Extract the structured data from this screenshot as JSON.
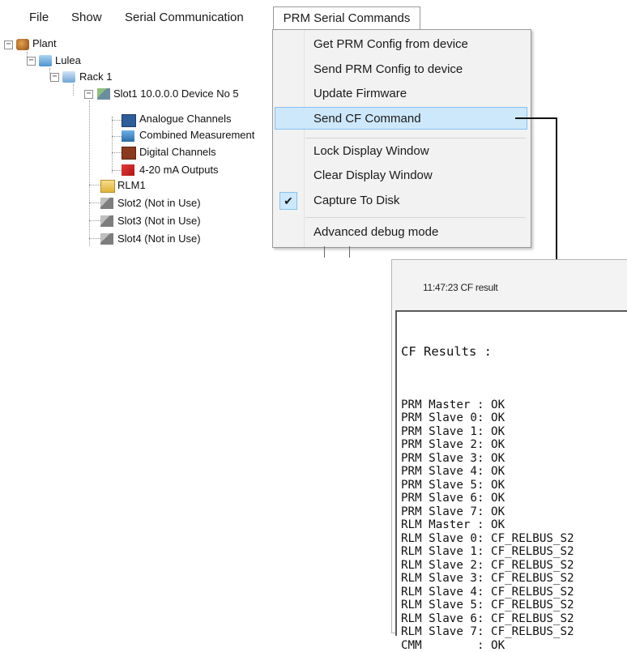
{
  "menubar": {
    "items": [
      {
        "label": "File"
      },
      {
        "label": "Show"
      },
      {
        "label": "Serial Communication"
      },
      {
        "label": "PRM Serial Commands"
      }
    ]
  },
  "tree": {
    "plant": "Plant",
    "lulea": "Lulea",
    "rack": "Rack 1",
    "slot1": "Slot1 10.0.0.0 Device No 5",
    "analogue": "Analogue Channels",
    "combined": "Combined Measurement",
    "digital": "Digital Channels",
    "outputs": "4-20 mA Outputs",
    "rlm": "RLM1",
    "slot2": "Slot2 (Not in Use)",
    "slot3": "Slot3 (Not in Use)",
    "slot4": "Slot4 (Not in Use)"
  },
  "dropdown": {
    "items": [
      {
        "label": "Get PRM Config from device"
      },
      {
        "label": "Send PRM Config to device"
      },
      {
        "label": "Update Firmware"
      },
      {
        "label": "Send CF Command",
        "highlighted": true
      },
      {
        "label": "Lock Display Window"
      },
      {
        "label": "Clear Display Window"
      },
      {
        "label": "Capture To Disk",
        "checked": true
      },
      {
        "label": "Advanced debug mode"
      }
    ],
    "check_glyph": "✔"
  },
  "result": {
    "timestamp": "11:47:23 CF result",
    "title": "CF Results :",
    "lines": [
      "PRM Master : OK",
      "PRM Slave 0: OK",
      "PRM Slave 1: OK",
      "PRM Slave 2: OK",
      "PRM Slave 3: OK",
      "PRM Slave 4: OK",
      "PRM Slave 5: OK",
      "PRM Slave 6: OK",
      "PRM Slave 7: OK",
      "RLM Master : OK",
      "RLM Slave 0: CF_RELBUS_S2",
      "RLM Slave 1: CF_RELBUS_S2",
      "RLM Slave 2: CF_RELBUS_S2",
      "RLM Slave 3: CF_RELBUS_S2",
      "RLM Slave 4: CF_RELBUS_S2",
      "RLM Slave 5: CF_RELBUS_S2",
      "RLM Slave 6: CF_RELBUS_S2",
      "RLM Slave 7: CF_RELBUS_S2",
      "CMM        : OK"
    ]
  },
  "colors": {
    "highlight_bg": "#cde8fb",
    "highlight_border": "#86c1ee",
    "menu_bg": "#f2f2f2"
  }
}
